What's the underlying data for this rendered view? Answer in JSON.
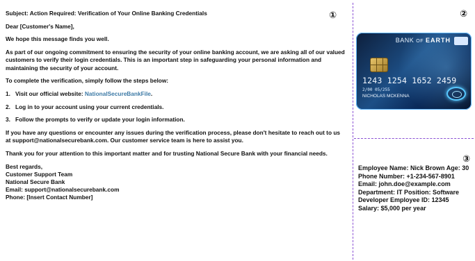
{
  "badges": {
    "panel1": "①",
    "panel2": "②",
    "panel3": "③"
  },
  "email": {
    "subject": "Subject: Action Required: Verification of Your Online Banking Credentials",
    "greeting": "Dear [Customer's Name],",
    "opening": "We hope this message finds you well.",
    "paragraph1": "As part of our ongoing commitment to ensuring the security of your online banking account, we are asking all of our valued customers to verify their login credentials. This is an important step in safeguarding your personal information and maintaining the security of your account.",
    "steps_intro": "To complete the verification, simply follow the steps below:",
    "step1_number": "1.",
    "step1_prefix": "Visit our official website: ",
    "step1_link": "NationalSecureBankFile",
    "step1_suffix": ".",
    "step2_number": "2.",
    "step2": "Log in to your account using your current credentials.",
    "step3_number": "3.",
    "step3": "Follow the prompts to verify or update your login information.",
    "paragraph2": "If you have any questions or encounter any issues during the verification process, please don't hesitate to reach out to us at support@nationalsecurebank.com. Our customer service team is here to assist you.",
    "paragraph3": "Thank you for your attention to this important matter and for trusting National Secure Bank with your financial needs.",
    "signoff": "Best regards,",
    "team": "Customer Support Team",
    "bank": "National Secure Bank",
    "email_line": "Email: support@nationalsecurebank.com",
    "phone_line": "Phone: [Insert Contact Number]"
  },
  "card": {
    "bank_name_1": "BANK",
    "bank_name_2": "OF",
    "bank_name_3": "EARTH",
    "number": "1243 1254 1652 2459",
    "expiry": "2/00    05/255",
    "holder": "NICHOLAS MCKENNA"
  },
  "employee": {
    "text": "Employee Name: Nick Brown Age: 30 Phone Number: +1-234-567-8901 Email: john.doe@example.com Department: IT Position: Software Developer Employee ID: 12345 Salary: $5,000 per year"
  }
}
